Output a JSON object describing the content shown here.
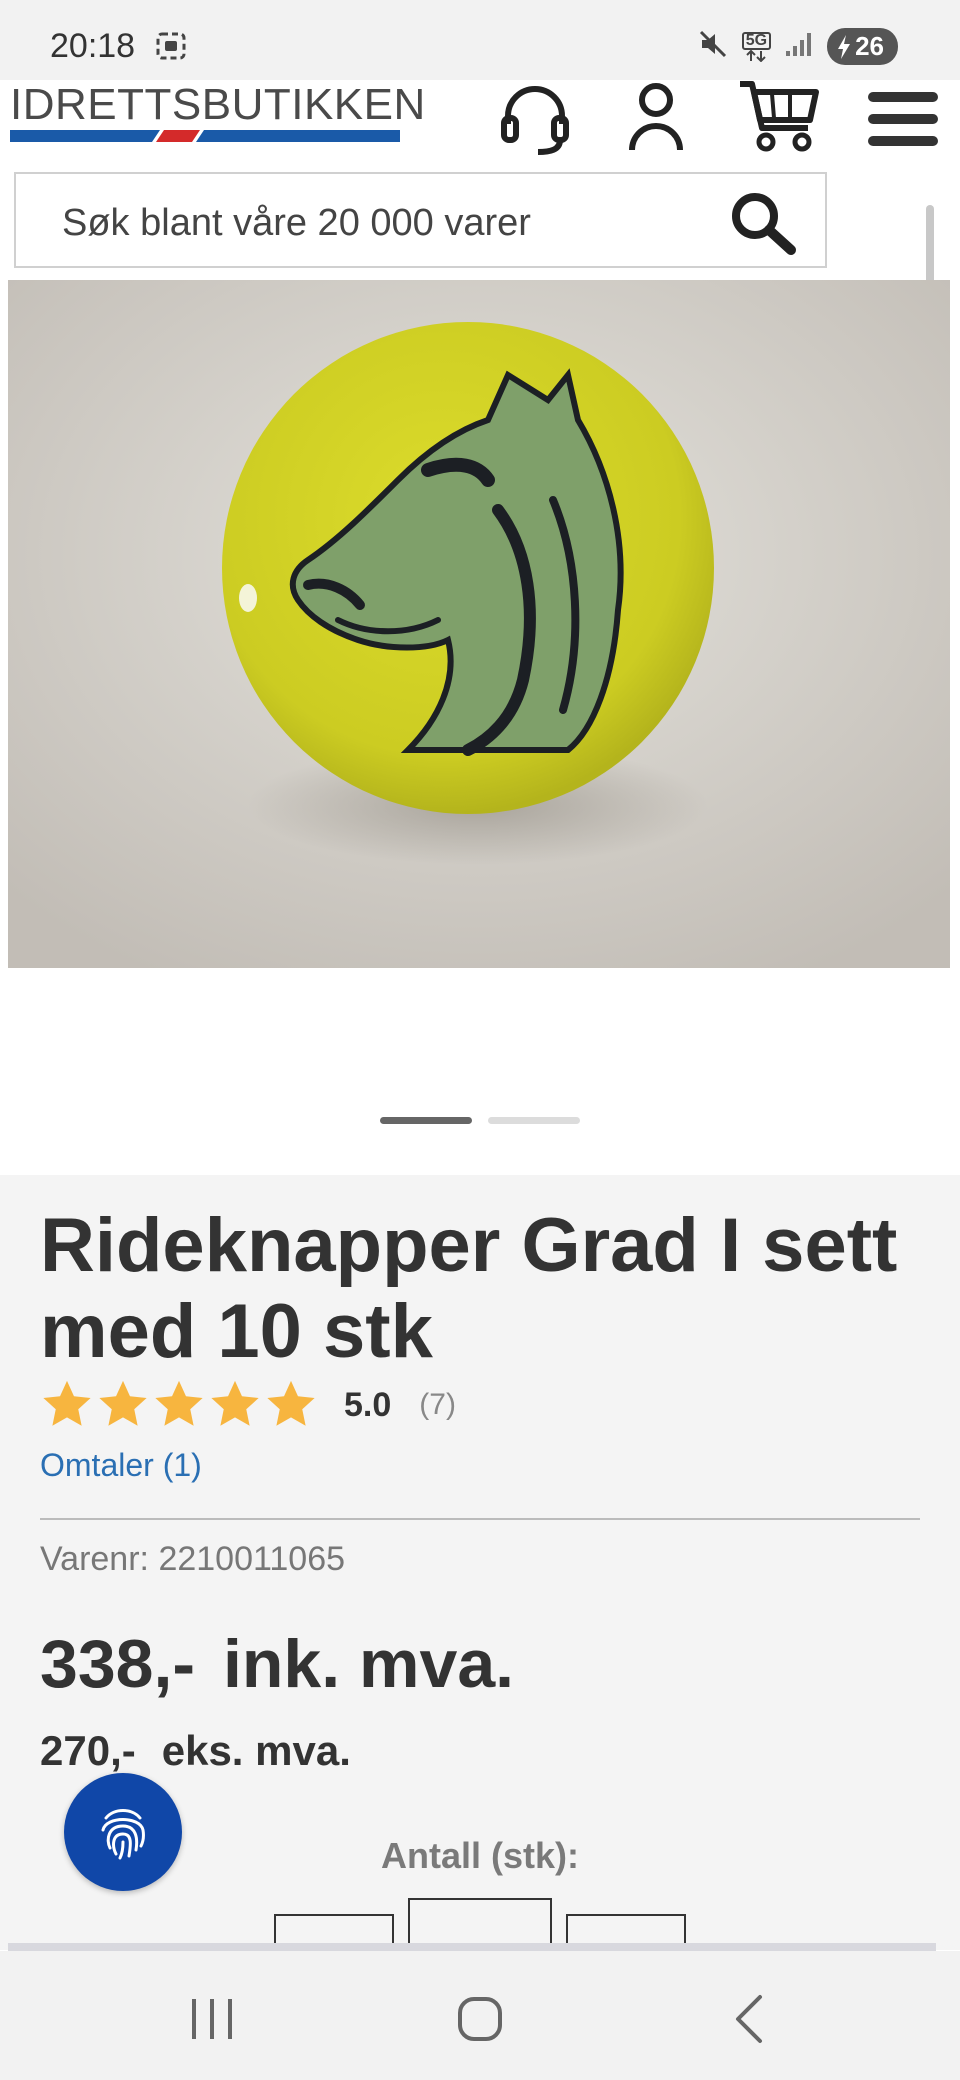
{
  "status_bar": {
    "time": "20:18",
    "network": "5G",
    "battery": "26",
    "icons": [
      "screenshot-icon",
      "mute-icon",
      "signal-icon",
      "charging-icon"
    ]
  },
  "header": {
    "logo": "IDRETTSBUTIKKEN",
    "icons": [
      "headset-icon",
      "account-icon",
      "cart-icon",
      "menu-icon"
    ]
  },
  "search": {
    "placeholder": "Søk blant våre 20 000 varer"
  },
  "gallery": {
    "image_subject": "horse-head-button-image",
    "slide_count": 2,
    "active_slide": 1
  },
  "product": {
    "title": "Rideknapper Grad I sett med 10 stk",
    "rating": {
      "stars_filled": 5,
      "stars_total": 5,
      "score": "5.0",
      "count": "(7)"
    },
    "reviews_link": "Omtaler (1)",
    "sku_label": "Varenr:",
    "sku_value": "2210011065",
    "price_inc": "338,-",
    "price_inc_label": "ink. mva.",
    "price_ex": "270,-",
    "price_ex_label": "eks. mva.",
    "quantity_label": "Antall (stk):"
  },
  "colors": {
    "star": "#f7b53f",
    "link": "#2a6fb3",
    "fab": "#1047a8",
    "logo_blue": "#1a5aa8",
    "logo_red": "#d42a2a",
    "button_yellow": "#d2d22a"
  },
  "navbar": {
    "buttons": [
      "recent-apps-icon",
      "home-icon",
      "back-icon"
    ]
  }
}
